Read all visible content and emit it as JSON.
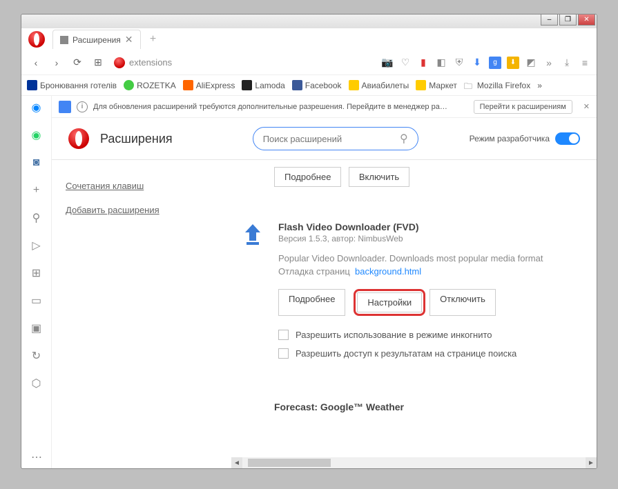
{
  "window": {
    "minimize": "–",
    "maximize": "❐",
    "close": "✕"
  },
  "tab": {
    "title": "Расширения",
    "close": "✕",
    "new": "+"
  },
  "nav": {
    "back": "‹",
    "forward": "›",
    "reload": "⟳",
    "speed": "⊞"
  },
  "url": {
    "text": "extensions"
  },
  "toolbar": {
    "camera": "📷",
    "heart": "♡",
    "gtr": "g",
    "shield": "⛨",
    "down": "⬇",
    "menu": "≡",
    "more": "»",
    "dl": "⤓",
    "hmenu": "≡"
  },
  "bookmarks": {
    "b1": "Бронювання готелів",
    "b2": "ROZETKA",
    "b3": "AliExpress",
    "b4": "Lamoda",
    "b5": "Facebook",
    "b6": "Авиабилеты",
    "b7": "Маркет",
    "b8": "Mozilla Firefox",
    "more": "»"
  },
  "sidebar": {},
  "infobar": {
    "text": "Для обновления расширений требуются дополнительные разрешения. Перейдите в менеджер ра…",
    "go": "Перейти к расширениям",
    "close": "✕"
  },
  "header": {
    "title": "Расширения",
    "search_ph": "Поиск расширений",
    "dev": "Режим разработчика"
  },
  "extnav": {
    "shortcuts": "Сочетания клавиш",
    "add": "Добавить расширения"
  },
  "topbtns": {
    "more": "Подробнее",
    "enable": "Включить"
  },
  "fvd": {
    "name": "Flash Video Downloader (FVD)",
    "meta": "Версия 1.5.3, автор: NimbusWeb",
    "desc": "Popular Video Downloader. Downloads most popular media format",
    "debug_label": "Отладка страниц",
    "debug_link": "background.html",
    "btn_more": "Подробнее",
    "btn_settings": "Настройки",
    "btn_disable": "Отключить",
    "chk1": "Разрешить использование в режиме инкогнито",
    "chk2": "Разрешить доступ к результатам на странице поиска"
  },
  "next": {
    "name": "Forecast: Google™ Weather"
  },
  "scroll": {
    "left": "◄",
    "right": "►"
  }
}
